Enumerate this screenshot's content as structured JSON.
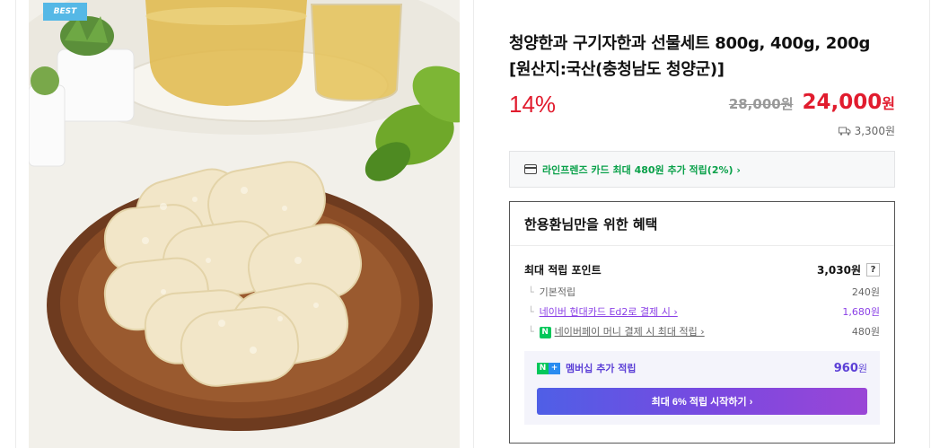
{
  "badge": {
    "label": "BEST"
  },
  "product": {
    "title": "청양한과 구기자한과 선물세트 800g, 400g, 200g [원산지:국산(충청남도 청양군)]",
    "discount": "14%",
    "original_price": "28,000원",
    "sale_price": "24,000",
    "sale_unit": "원",
    "shipping_fee": "3,300원"
  },
  "card_promo": {
    "text": "라인프렌즈 카드 최대 480원 추가 적립(2%) ›"
  },
  "benefit": {
    "heading": "한용환님만을 위한 혜택",
    "max_label": "최대 적립 포인트",
    "max_value": "3,030원",
    "help": "?",
    "rows": [
      {
        "label": "기본적립",
        "value": "240원"
      },
      {
        "label": "네이버 현대카드 Ed2로 결제 시 ›",
        "value": "1,680원"
      },
      {
        "label": "네이버페이 머니 결제 시 최대 적립 ›",
        "value": "480원"
      }
    ],
    "npay_glyph": "N",
    "member": {
      "label": "멤버십 추가 적립",
      "amount": "960",
      "unit": "원",
      "button": "최대 6% 적립 시작하기 ›"
    }
  },
  "icons": [
    "truck-icon",
    "credit-card-icon",
    "npay-icon",
    "naver-plus-icon",
    "help-icon"
  ],
  "colors": {
    "accent_red": "#e11c2e",
    "naver_green": "#03c75a",
    "membership_purple": "#5b3fd6",
    "badge_blue": "#55b8e6"
  }
}
